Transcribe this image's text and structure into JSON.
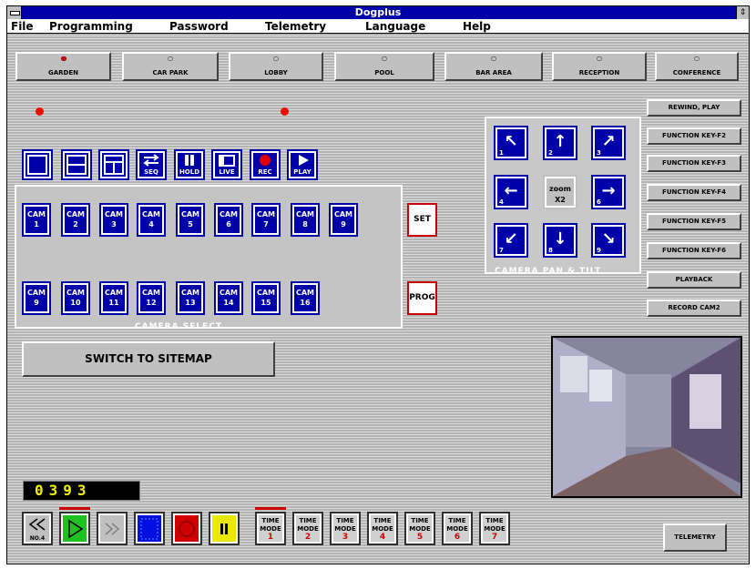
{
  "window": {
    "title": "Dogplus"
  },
  "menu": [
    "File",
    "Programming",
    "Password",
    "Telemetry",
    "Language",
    "Help"
  ],
  "presets": [
    {
      "label": "GARDEN",
      "active": true
    },
    {
      "label": "CAR PARK",
      "active": false
    },
    {
      "label": "LOBBY",
      "active": false
    },
    {
      "label": "POOL",
      "active": false
    },
    {
      "label": "BAR AREA",
      "active": false
    },
    {
      "label": "RECEPTION",
      "active": false
    },
    {
      "label": "CONFERENCE",
      "active": false
    }
  ],
  "function_keys": [
    "REWIND, PLAY",
    "FUNCTION KEY-F2",
    "FUNCTION KEY-F3",
    "FUNCTION KEY-F4",
    "FUNCTION KEY-F5",
    "FUNCTION KEY-F6",
    "PLAYBACK",
    "RECORD CAM2"
  ],
  "view_modes": [
    {
      "label": "",
      "icon": "single-view-icon"
    },
    {
      "label": "",
      "icon": "split-view-icon"
    },
    {
      "label": "",
      "icon": "quad-view-icon"
    },
    {
      "label": "SEQ",
      "icon": "sequence-icon"
    },
    {
      "label": "HOLD",
      "icon": "pause-icon"
    },
    {
      "label": "LIVE",
      "icon": "live-icon"
    },
    {
      "label": "REC",
      "icon": "record-icon"
    },
    {
      "label": "PLAY",
      "icon": "play-icon"
    }
  ],
  "camera_select": {
    "title": "CAMERA SELECT",
    "cams": [
      {
        "line1": "CAM",
        "line2": "1"
      },
      {
        "line1": "CAM",
        "line2": "2"
      },
      {
        "line1": "CAM",
        "line2": "3"
      },
      {
        "line1": "CAM",
        "line2": "4"
      },
      {
        "line1": "CAM",
        "line2": "5"
      },
      {
        "line1": "CAM",
        "line2": "6"
      },
      {
        "line1": "CAM",
        "line2": "7"
      },
      {
        "line1": "CAM",
        "line2": "8"
      },
      {
        "line1": "CAM",
        "line2": "9"
      },
      {
        "line1": "CAM",
        "line2": "10"
      },
      {
        "line1": "CAM",
        "line2": "11"
      },
      {
        "line1": "CAM",
        "line2": "12"
      },
      {
        "line1": "CAM",
        "line2": "13"
      },
      {
        "line1": "CAM",
        "line2": "14"
      },
      {
        "line1": "CAM",
        "line2": "15"
      },
      {
        "line1": "CAM",
        "line2": "16"
      }
    ],
    "set_label": "SET",
    "prog_label": "PROG"
  },
  "pan_tilt": {
    "title": "CAMERA PAN & TILT",
    "zoom_label": "zoom",
    "zoom_value": "X2",
    "buttons": [
      {
        "arrow": "↖",
        "n": "1"
      },
      {
        "arrow": "↑",
        "n": "2"
      },
      {
        "arrow": "↗",
        "n": "3"
      },
      {
        "arrow": "←",
        "n": "4"
      },
      {
        "arrow": "",
        "n": ""
      },
      {
        "arrow": "→",
        "n": "6"
      },
      {
        "arrow": "↙",
        "n": "7"
      },
      {
        "arrow": "↓",
        "n": "8"
      },
      {
        "arrow": "↘",
        "n": "9"
      }
    ]
  },
  "switch_label": "SWITCH TO SITEMAP",
  "counter": "0393",
  "transport": [
    {
      "label": "NO.4",
      "icon": "rewind-icon"
    },
    {
      "label": "",
      "icon": "play-icon"
    },
    {
      "label": "",
      "icon": "fast-forward-icon"
    },
    {
      "label": "",
      "icon": "stop-icon"
    },
    {
      "label": "",
      "icon": "record-icon"
    },
    {
      "label": "",
      "icon": "pause-icon"
    }
  ],
  "time_modes": [
    {
      "label": "TIME MODE",
      "n": "1"
    },
    {
      "label": "TIME MODE",
      "n": "2"
    },
    {
      "label": "TIME MODE",
      "n": "3"
    },
    {
      "label": "TIME MODE",
      "n": "4"
    },
    {
      "label": "TIME MODE",
      "n": "5"
    },
    {
      "label": "TIME MODE",
      "n": "6"
    },
    {
      "label": "TIME MODE",
      "n": "7"
    }
  ],
  "telemetry_label": "TELEMETRY",
  "colors": {
    "title_bar": "#0000a8",
    "button_blue": "#0000a8",
    "led_red": "#e81000",
    "counter_yellow": "#f0f000"
  }
}
